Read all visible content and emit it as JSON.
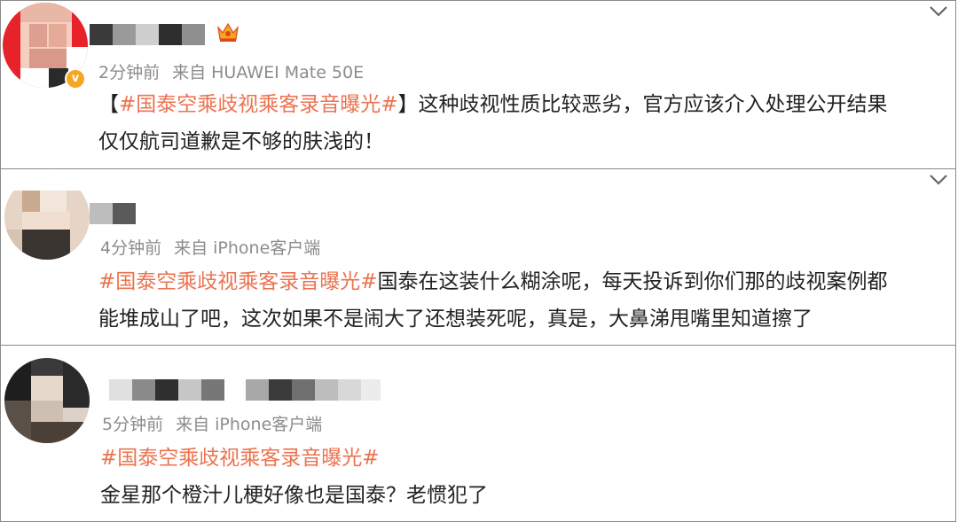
{
  "comments": [
    {
      "time": "2分钟前",
      "source": "来自 HUAWEI Mate 50E",
      "lines": [
        [
          "【",
          "#国泰空乘歧视乘客录音曝光#",
          "】这种歧视性质比较恶劣，官方应该介入处理公开结果"
        ],
        [
          "仅仅航司道歉是不够的肤浅的！"
        ]
      ]
    },
    {
      "time": "4分钟前",
      "source": "来自 iPhone客户端",
      "lines": [
        [
          "",
          "#国泰空乘歧视乘客录音曝光#",
          "国泰在这装什么糊涂呢，每天投诉到你们那的歧视案例都"
        ],
        [
          "能堆成山了吧，这次如果不是闹大了还想装死呢，真是，大鼻涕甩嘴里知道擦了"
        ]
      ]
    },
    {
      "time": "5分钟前",
      "source": "来自 iPhone客户端",
      "lines": [
        [
          "",
          "#国泰空乘歧视乘客录音曝光#",
          ""
        ],
        [
          "金星那个橙汁儿梗好像也是国泰？老惯犯了"
        ]
      ]
    }
  ],
  "icons": {
    "crown": "crown-icon",
    "verified": "verified-badge-icon",
    "expand": "chevron-down-icon"
  },
  "colors": {
    "topic": "#eb7350",
    "meta": "#8c8c8c",
    "text": "#222222",
    "verified": "#f5a623"
  }
}
